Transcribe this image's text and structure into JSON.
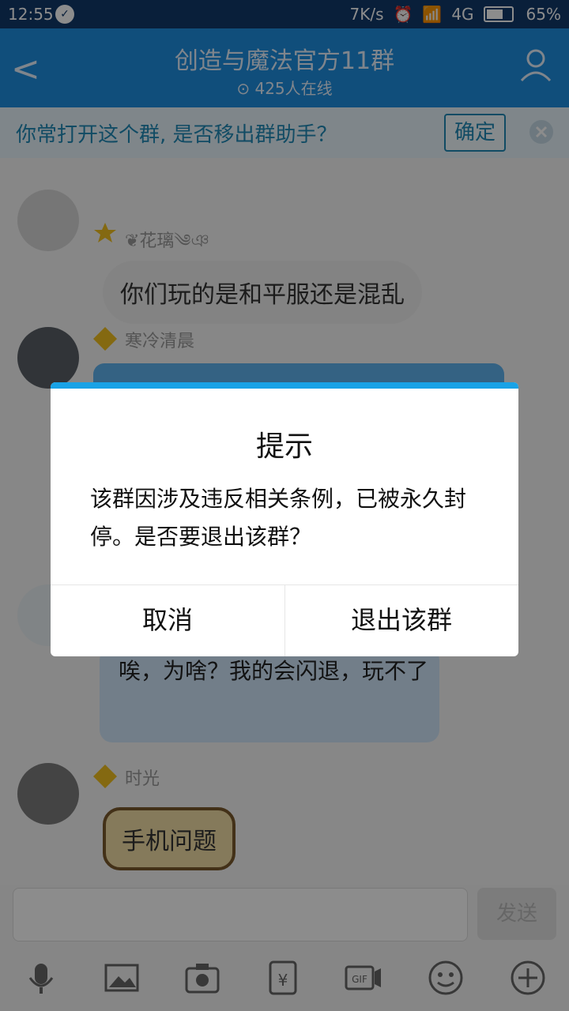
{
  "status_bar": {
    "time": "12:55",
    "speed": "7K/s",
    "network": "4G",
    "battery": "65%"
  },
  "header": {
    "title": "创造与魔法官方11群",
    "online": "425人在线"
  },
  "banner": {
    "text": "你常打开这个群, 是否移出群助手？",
    "ok_label": "确定"
  },
  "chat": {
    "messages": [
      {
        "name": "❦花璃༄ঞ",
        "text": "你们玩的是和平服还是混乱"
      },
      {
        "name": "寒冷清晨",
        "text": ""
      },
      {
        "name": "",
        "text": "唉，为啥？我的会闪退，玩不了"
      },
      {
        "name": "时光",
        "text": "手机问题"
      }
    ]
  },
  "input": {
    "send_label": "发送"
  },
  "dialog": {
    "title": "提示",
    "message": "该群因涉及违反相关条例，已被永久封停。是否要退出该群？",
    "cancel_label": "取消",
    "exit_label": "退出该群"
  },
  "colors": {
    "header": "#1e8fe0",
    "banner_text": "#1f89b6",
    "dialog_accent": "#19a2e6"
  }
}
